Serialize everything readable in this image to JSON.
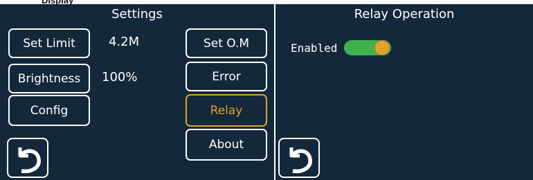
{
  "top_caption": "Display",
  "left_screen": {
    "title": "Settings",
    "buttons": {
      "set_limit": "Set Limit",
      "brightness": "Brightness",
      "config": "Config",
      "set_om": "Set O.M",
      "error": "Error",
      "relay": "Relay",
      "about": "About"
    },
    "values": {
      "limit": "4.2M",
      "brightness": "100%"
    },
    "back_icon": "undo-arrow-icon"
  },
  "right_screen": {
    "title": "Relay Operation",
    "relay_label": "Enabled",
    "relay_enabled": true,
    "back_icon": "undo-arrow-icon"
  },
  "colors": {
    "background": "#13283a",
    "text": "#ffffff",
    "accent": "#e0a22a",
    "toggle_on": "#3fb24e"
  }
}
